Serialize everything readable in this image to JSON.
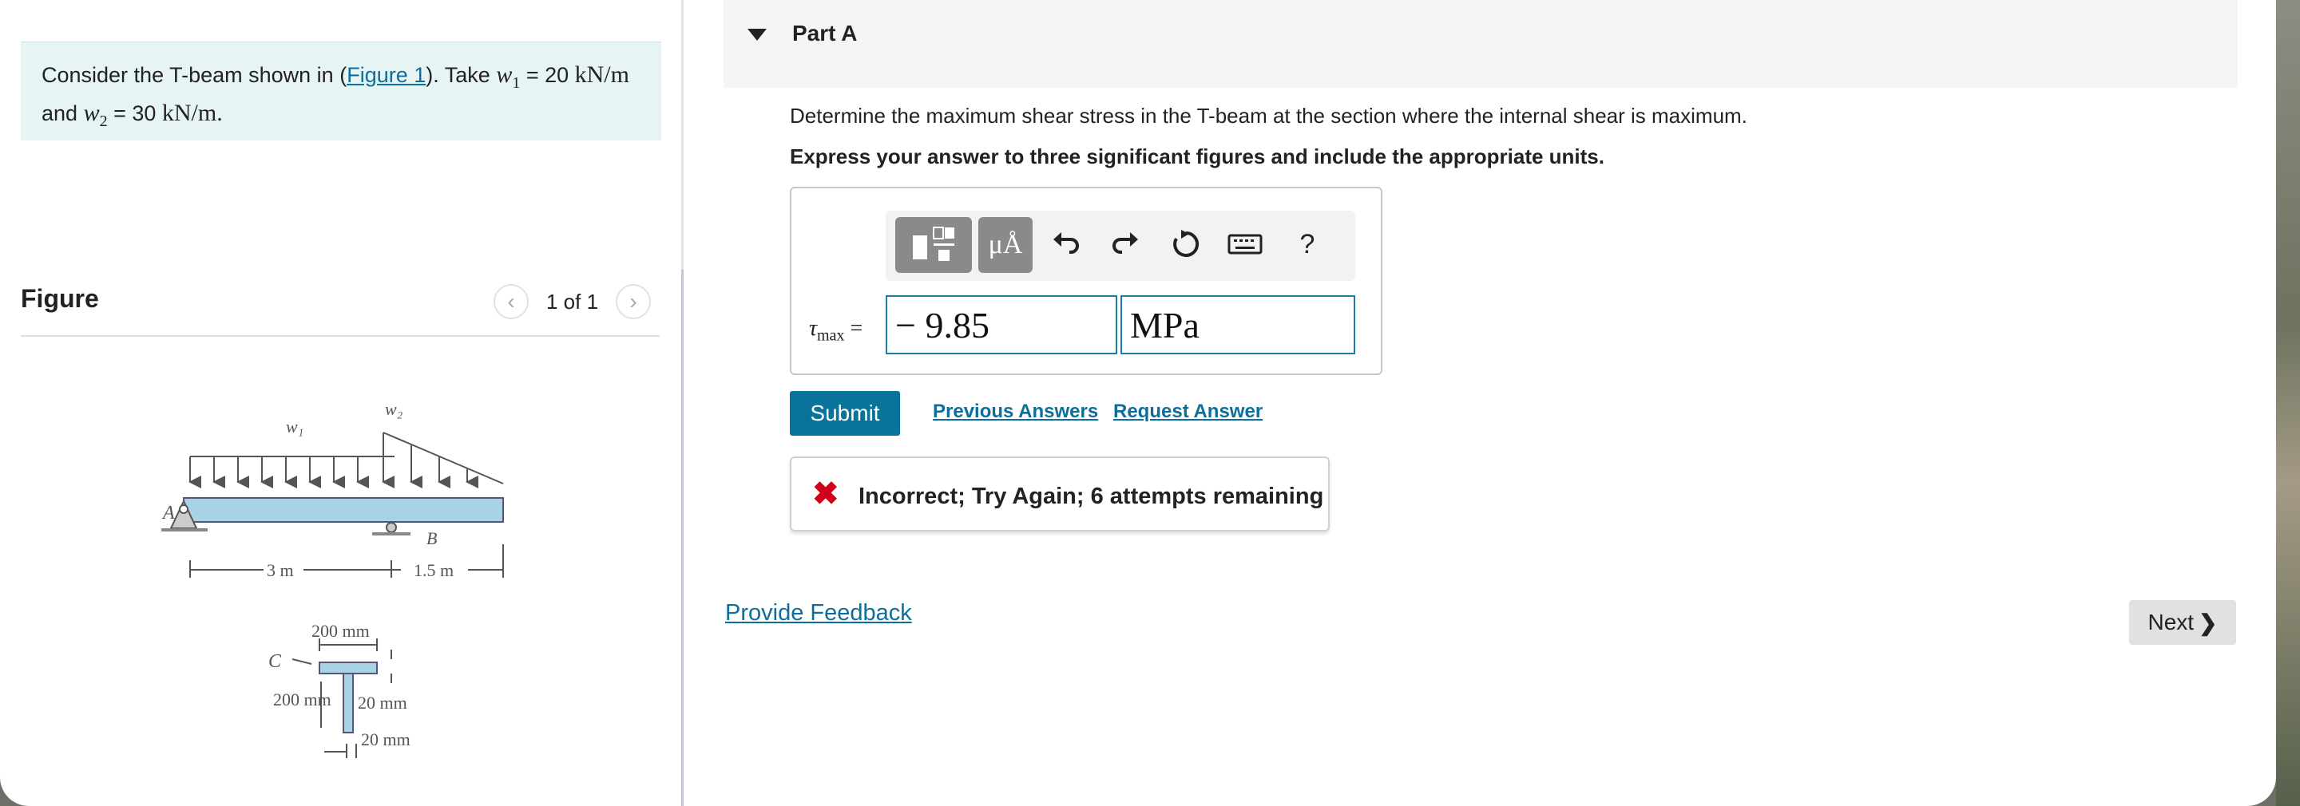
{
  "intro": {
    "text1": "Consider the T-beam shown in (",
    "fig_link": "Figure 1",
    "text2": "). Take ",
    "w1": "w",
    "w1_sub": "1",
    "eq1": " = 20 ",
    "unit1": "kN/m",
    "text3": "and ",
    "w2": "w",
    "w2_sub": "2",
    "eq2": " = 30 ",
    "unit2": "kN/m."
  },
  "figure": {
    "title": "Figure",
    "count": "1 of 1",
    "labels": {
      "w1": "w₁",
      "w2": "w₂",
      "A": "A",
      "B": "B",
      "C": "C",
      "span1": "3 m",
      "span2": "1.5 m",
      "flange_width": "200 mm",
      "web_depth": "200 mm",
      "flange_thk": "20 mm",
      "web_thk": "20 mm"
    }
  },
  "part": {
    "title": "Part A",
    "question": "Determine the maximum shear stress in the T-beam at the section where the internal shear is maximum.",
    "instruction": "Express your answer to three significant figures and include the appropriate units."
  },
  "answer": {
    "label_symbol": "τ",
    "label_sub": "max",
    "label_eq": " =",
    "value": "− 9.85",
    "unit": "MPa",
    "toolbar": {
      "units_glyph": "μÅ",
      "help_glyph": "?"
    }
  },
  "actions": {
    "submit": "Submit",
    "previous_answers": "Previous Answers",
    "request_answer": "Request Answer"
  },
  "feedback": {
    "mark": "✖",
    "message": "Incorrect; Try Again; 6 attempts remaining"
  },
  "footer": {
    "provide_feedback": "Provide Feedback",
    "next": "Next"
  },
  "colors": {
    "accent": "#0a7399",
    "error": "#d0021b",
    "intro_bg": "#e6f4f3"
  }
}
